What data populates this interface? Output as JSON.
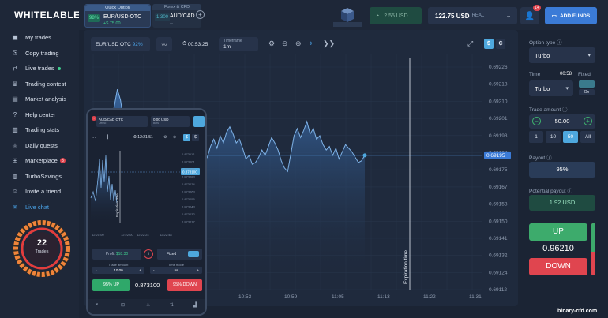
{
  "logo": "WHITELABLE",
  "sidebar": {
    "items": [
      {
        "label": "My trades",
        "icon": "briefcase-icon",
        "glyph": "▣"
      },
      {
        "label": "Copy trading",
        "icon": "copy-icon",
        "glyph": "⎘"
      },
      {
        "label": "Live trades",
        "icon": "live-icon",
        "glyph": "⇄"
      },
      {
        "label": "Trading contest",
        "icon": "trophy-icon",
        "glyph": "♛"
      },
      {
        "label": "Market analysis",
        "icon": "chart-icon",
        "glyph": "▤"
      },
      {
        "label": "Help center",
        "icon": "help-icon",
        "glyph": "?"
      },
      {
        "label": "Trading stats",
        "icon": "stats-icon",
        "glyph": "▥"
      },
      {
        "label": "Daily quests",
        "icon": "quest-icon",
        "glyph": "◎"
      },
      {
        "label": "Marketplace",
        "icon": "cart-icon",
        "glyph": "⊞",
        "badge": "3"
      },
      {
        "label": "TurboSavings",
        "icon": "piggy-icon",
        "glyph": "◍"
      },
      {
        "label": "Invite a friend",
        "icon": "invite-icon",
        "glyph": "☺"
      },
      {
        "label": "Live chat",
        "icon": "chat-icon",
        "glyph": "✉"
      }
    ],
    "donut_value": "22",
    "donut_label": "Trades"
  },
  "tabs": [
    {
      "header": "Quick Option",
      "pct": "98%",
      "name": "EUR/USD OTC",
      "sub": "+$ 75.00"
    },
    {
      "header": "Forex & CFD",
      "pct": "1:300",
      "name": "AUD/CAD",
      "sub": "..."
    }
  ],
  "account": {
    "demo_balance": "2.55 USD",
    "real_balance": "122.75 USD",
    "real_label": "REAL",
    "notifications": "14",
    "add_funds": "ADD FUNDS"
  },
  "chart_toolbar": {
    "asset": "EUR/USD OTC",
    "asset_pct": "92%",
    "timer": "00:53:25",
    "timeframe_label": "Timeframe",
    "timeframe_value": "1m",
    "currency_s": "$",
    "currency_c": "₵"
  },
  "chart_data": {
    "type": "area",
    "y_ticks": [
      "0.69226",
      "0.69218",
      "0.69210",
      "0.69201",
      "0.69193",
      "0.69184",
      "0.69175",
      "0.69167",
      "0.69158",
      "0.69150",
      "0.69141",
      "0.69132",
      "0.69124",
      "0.69112"
    ],
    "x_ticks": [
      "10:53",
      "10:59",
      "11:05",
      "11:13",
      "11:22",
      "11:31"
    ],
    "ylim": [
      0.69112,
      0.69226
    ],
    "current_price": "0.69195",
    "expiration_label": "Expiration time",
    "series": [
      {
        "values": [
          0.69172,
          0.6917,
          0.69175,
          0.69178,
          0.69183,
          0.69188,
          0.69196,
          0.69204,
          0.69214,
          0.69208,
          0.69196,
          0.69186,
          0.6918,
          0.69186,
          0.69178,
          0.69172,
          0.69176,
          0.69182,
          0.69188,
          0.69184,
          0.69192,
          0.69186,
          0.6918,
          0.69174,
          0.69168,
          0.69171,
          0.69164,
          0.69166,
          0.6916,
          0.69158,
          0.69162,
          0.69158,
          0.69155,
          0.69161,
          0.69167,
          0.69173,
          0.69176,
          0.69182,
          0.69186,
          0.69181,
          0.69188,
          0.69184,
          0.6919,
          0.69193,
          0.69189,
          0.69184,
          0.69186,
          0.69181,
          0.69175,
          0.69177,
          0.69172,
          0.69173,
          0.69176,
          0.6918,
          0.69177,
          0.69182,
          0.69187,
          0.69184,
          0.6918,
          0.69174,
          0.6917,
          0.69168,
          0.69178,
          0.69188,
          0.69192,
          0.69187,
          0.69191,
          0.69196,
          0.69189,
          0.69192,
          0.69186,
          0.69188,
          0.69183,
          0.6918,
          0.69182,
          0.69177,
          0.69181,
          0.69175,
          0.69179,
          0.69183,
          0.69181,
          0.69179,
          0.69176,
          0.69173,
          0.69174,
          0.69177
        ]
      }
    ]
  },
  "phone": {
    "asset": "AUD/CAD OTC",
    "asset_sub": "Demo",
    "balance": "0.00 USD",
    "balance_sub": "Bets",
    "timer": "12:21:51",
    "prices": [
      "0.873112",
      "0.873101",
      "0.873093",
      "0.873083",
      "0.873074",
      "0.873063",
      "0.873055",
      "0.873043",
      "0.873032",
      "0.873017"
    ],
    "current": "0.873100",
    "times": [
      "12:21:00",
      "12:22:00",
      "12:22:24",
      "12:22:48"
    ],
    "expiration": "Expiration time",
    "profit_label": "Profit",
    "profit_value": "$18.30",
    "fixed_label": "Fixed",
    "trade_amount_label": "Trade amount",
    "trade_amount": "10.00",
    "time_mode_label": "Time mode",
    "time_mode": "5s",
    "up_label": "95% UP",
    "down_label": "95% DOWN",
    "price": "0.873100"
  },
  "panel": {
    "option_type_label": "Option type",
    "option_type": "Turbo",
    "time_label": "Time",
    "time_value": "00:58",
    "fixed_label": "Fixed",
    "time_select": "Turbo",
    "toggle": "On",
    "trade_amount_label": "Trade amount",
    "amount": "50.00",
    "amounts": [
      "1",
      "10",
      "50",
      "All"
    ],
    "payout_label": "Payout",
    "payout": "95%",
    "potential_label": "Potential payout",
    "potential": "1.92 USD",
    "up": "UP",
    "down": "DOWN",
    "price": "0.96210",
    "up_share": 0.55
  },
  "watermark": "binary-cfd.com"
}
